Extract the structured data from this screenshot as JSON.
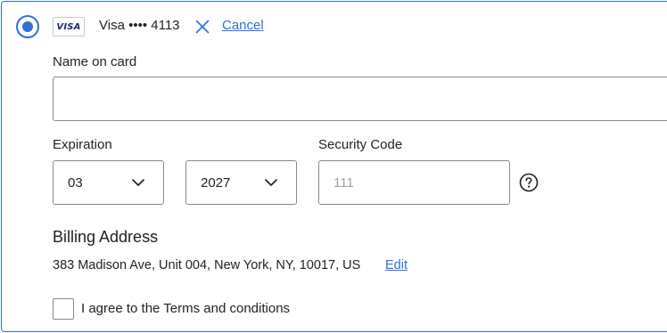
{
  "payment_method": {
    "selected": true,
    "brand_label": "VISA",
    "card_number": "Visa •••• 4113",
    "cancel_label": "Cancel"
  },
  "form": {
    "name_label": "Name on card",
    "name_value": "",
    "expiration_label": "Expiration",
    "month_value": "03",
    "year_value": "2027",
    "security_label": "Security Code",
    "security_placeholder": "111"
  },
  "billing": {
    "heading": "Billing Address",
    "address": "383 Madison Ave, Unit 004, New York, NY, 10017, US",
    "edit_label": "Edit"
  },
  "terms": {
    "checked": false,
    "label": "I agree to the Terms and conditions"
  },
  "icons": {
    "cancel": "close-icon",
    "select": "chevron-down-icon",
    "help": "question-circle-icon"
  },
  "colors": {
    "accent": "#2f6fdc",
    "border": "#8a8a8a",
    "text": "#222222",
    "placeholder": "#a3a3a3"
  }
}
